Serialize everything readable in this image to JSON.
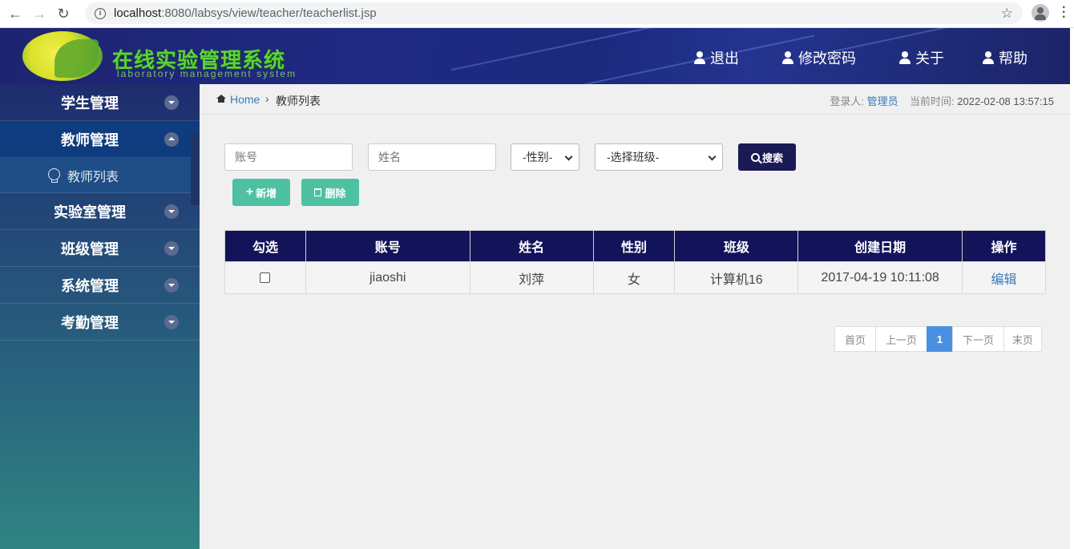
{
  "browser": {
    "url_host": "localhost",
    "url_rest": ":8080/labsys/view/teacher/teacherlist.jsp"
  },
  "header": {
    "title": "在线实验管理系统",
    "subtitle": "laboratory management system",
    "nav": [
      {
        "label": "退出"
      },
      {
        "label": "修改密码"
      },
      {
        "label": "关于"
      },
      {
        "label": "帮助"
      }
    ]
  },
  "sidebar": {
    "items": [
      {
        "label": "学生管理",
        "expanded": false
      },
      {
        "label": "教师管理",
        "expanded": true,
        "children": [
          {
            "label": "教师列表"
          }
        ]
      },
      {
        "label": "实验室管理",
        "expanded": false
      },
      {
        "label": "班级管理",
        "expanded": false
      },
      {
        "label": "系统管理",
        "expanded": false
      },
      {
        "label": "考勤管理",
        "expanded": false
      }
    ]
  },
  "breadcrumb": {
    "home": "Home",
    "current": "教师列表",
    "login_label": "登录人:",
    "login_user": "管理员",
    "time_label": "当前时间:",
    "time_value": "2022-02-08 13:57:15"
  },
  "search": {
    "account_placeholder": "账号",
    "name_placeholder": "姓名",
    "gender_selected": "-性别-",
    "class_selected": "-选择班级-",
    "search_label": "搜索"
  },
  "actions": {
    "add_label": "新增",
    "delete_label": "删除"
  },
  "table": {
    "headers": [
      "勾选",
      "账号",
      "姓名",
      "性别",
      "班级",
      "创建日期",
      "操作"
    ],
    "rows": [
      {
        "account": "jiaoshi",
        "name": "刘萍",
        "gender": "女",
        "class": "计算机16",
        "created": "2017-04-19 10:11:08",
        "action": "编辑"
      }
    ]
  },
  "pagination": {
    "first": "首页",
    "prev": "上一页",
    "current": "1",
    "next": "下一页",
    "last": "末页"
  },
  "colors": {
    "header_bg": "#1d2370",
    "table_header": "#13135a",
    "search_button": "#1a1a55",
    "green_button": "#4ec1a3",
    "active_page": "#4a90e2",
    "link": "#3c7ab8"
  }
}
